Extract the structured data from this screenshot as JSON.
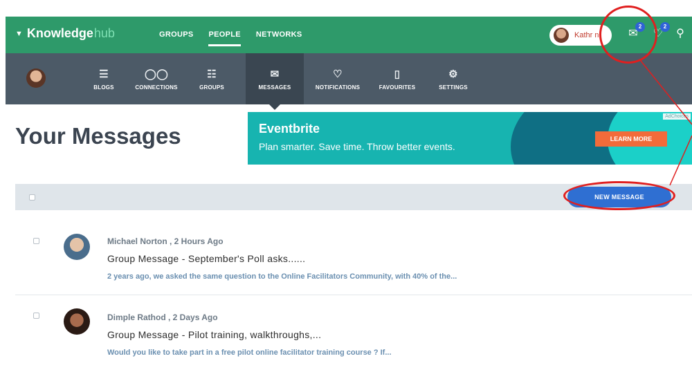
{
  "brand": {
    "name": "Knowledge",
    "suffix": "hub"
  },
  "topnav": {
    "items": [
      {
        "label": "GROUPS"
      },
      {
        "label": "PEOPLE",
        "active": true
      },
      {
        "label": "NETWORKS"
      }
    ]
  },
  "user": {
    "name": "Kathryn",
    "visible_name": "Kathr n"
  },
  "badges": {
    "messages": "2",
    "notifications": "2"
  },
  "subnav": {
    "items": [
      {
        "label": "BLOGS",
        "icon": "blog-icon"
      },
      {
        "label": "CONNECTIONS",
        "icon": "connections-icon"
      },
      {
        "label": "GROUPS",
        "icon": "groups-icon"
      },
      {
        "label": "MESSAGES",
        "icon": "envelope-icon",
        "active": true
      },
      {
        "label": "NOTIFICATIONS",
        "icon": "bell-icon"
      },
      {
        "label": "FAVOURITES",
        "icon": "bookmark-icon"
      },
      {
        "label": "SETTINGS",
        "icon": "gear-icon"
      }
    ]
  },
  "page": {
    "title": "Your Messages"
  },
  "ad": {
    "brand": "Eventbrite",
    "tagline": "Plan smarter. Save time. Throw better events.",
    "cta": "LEARN MORE",
    "choices": "AdChoices"
  },
  "toolbar": {
    "new_message": "NEW MESSAGE"
  },
  "messages": [
    {
      "meta": "Michael Norton , 2 Hours Ago",
      "subject": "Group Message - September's Poll asks......",
      "preview": "2 years ago, we asked the same question to the Online Facilitators Community, with 40% of the..."
    },
    {
      "meta": "Dimple Rathod , 2 Days Ago",
      "subject": "Group Message - Pilot training, walkthroughs,...",
      "preview": "Would you like to take part in a free pilot online facilitator training course ?  If..."
    }
  ],
  "colors": {
    "green": "#2e9a6a",
    "subnav": "#4c5a67",
    "accent": "#2f6fd2",
    "annotation": "#e01f1f"
  }
}
